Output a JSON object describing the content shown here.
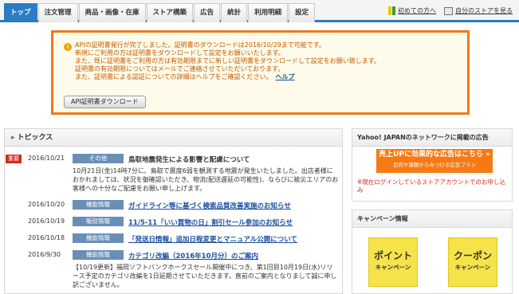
{
  "nav": {
    "tabs": [
      "トップ",
      "注文管理",
      "商品・画像・在庫",
      "ストア構築",
      "広告",
      "統計",
      "利用明細",
      "設定"
    ],
    "links": {
      "beginner": "初めての方へ",
      "view_store": "自分のストアを見る"
    }
  },
  "notice": {
    "lines": [
      "APIの証明書発行が完了しました。証明書のダウンロードは2016/10/29まで可能です。",
      "新規にご利用の方は証明書をダウンロードして設定をお願いいたします。",
      "また、既に証明書をご利用の方は有効期限までに新しい証明書をダウンロードして設定をお願い致します。",
      "証明書の有効期限についてはメールでご連絡させていただいております。"
    ],
    "last_line": "また、証明書による認証についての詳細はヘルプをご確認ください。",
    "help_link": "ヘルプ",
    "button": "API証明書ダウンロード"
  },
  "topics": {
    "title": "トピックス",
    "items": [
      {
        "badge": "重要",
        "date": "2016/10/21",
        "category": "その他",
        "title": "鳥取地震発生による影響と配慮について",
        "body": "10月21日(金)14時7分に、鳥取で震度6弱を観測する地震が発生いたしました。出店者様におかれましては、状況を御確認いただき、物流(配送遅延の可能性)、ならびに被災エリアのお客様への十分なご配慮をお願い申し上げます。"
      },
      {
        "date": "2016/10/20",
        "category": "機能情報",
        "title": "ガイドライン等に基づく検索品質改善実施のお知らせ"
      },
      {
        "date": "2016/10/19",
        "category": "販促情報",
        "title": "11/5-11「いい買物の日」割引セール参加のお知らせ"
      },
      {
        "date": "2016/10/18",
        "category": "機能情報",
        "title": "「発送日情報」追加日程変更とマニュアル公開について"
      },
      {
        "date": "2016/9/30",
        "category": "機能情報",
        "title": "カテゴリ改編（2016年10月分）のご案内",
        "body": "【10/19更新】福岡ソフトバンクホークスセール開催中につき、第1回目10月19日(水)リリース予定のカテゴリ改編を1日延期させていただきます。直前のご案内となりまして誠に申し訳ございません。"
      }
    ]
  },
  "ad": {
    "head": "Yahoo! JAPANのネットワークに掲載の広告",
    "banner_main": "売上UPに効果的な広告はこちら »",
    "banner_sub": "目的や課題からみつける広告プラン",
    "note": "※現在ログインしているストアアカウントでのお申し込み"
  },
  "campaign": {
    "head": "キャンペーン情報",
    "point": {
      "line1": "ポイント",
      "line2": "キャンペーン"
    },
    "coupon": {
      "line1": "クーポン",
      "line2": "キャンペーン"
    }
  },
  "colors": {
    "accent": "#2c7cc3",
    "notice_border": "#f07a1b",
    "notice_text": "#c35a00",
    "important": "#d12b1e"
  }
}
